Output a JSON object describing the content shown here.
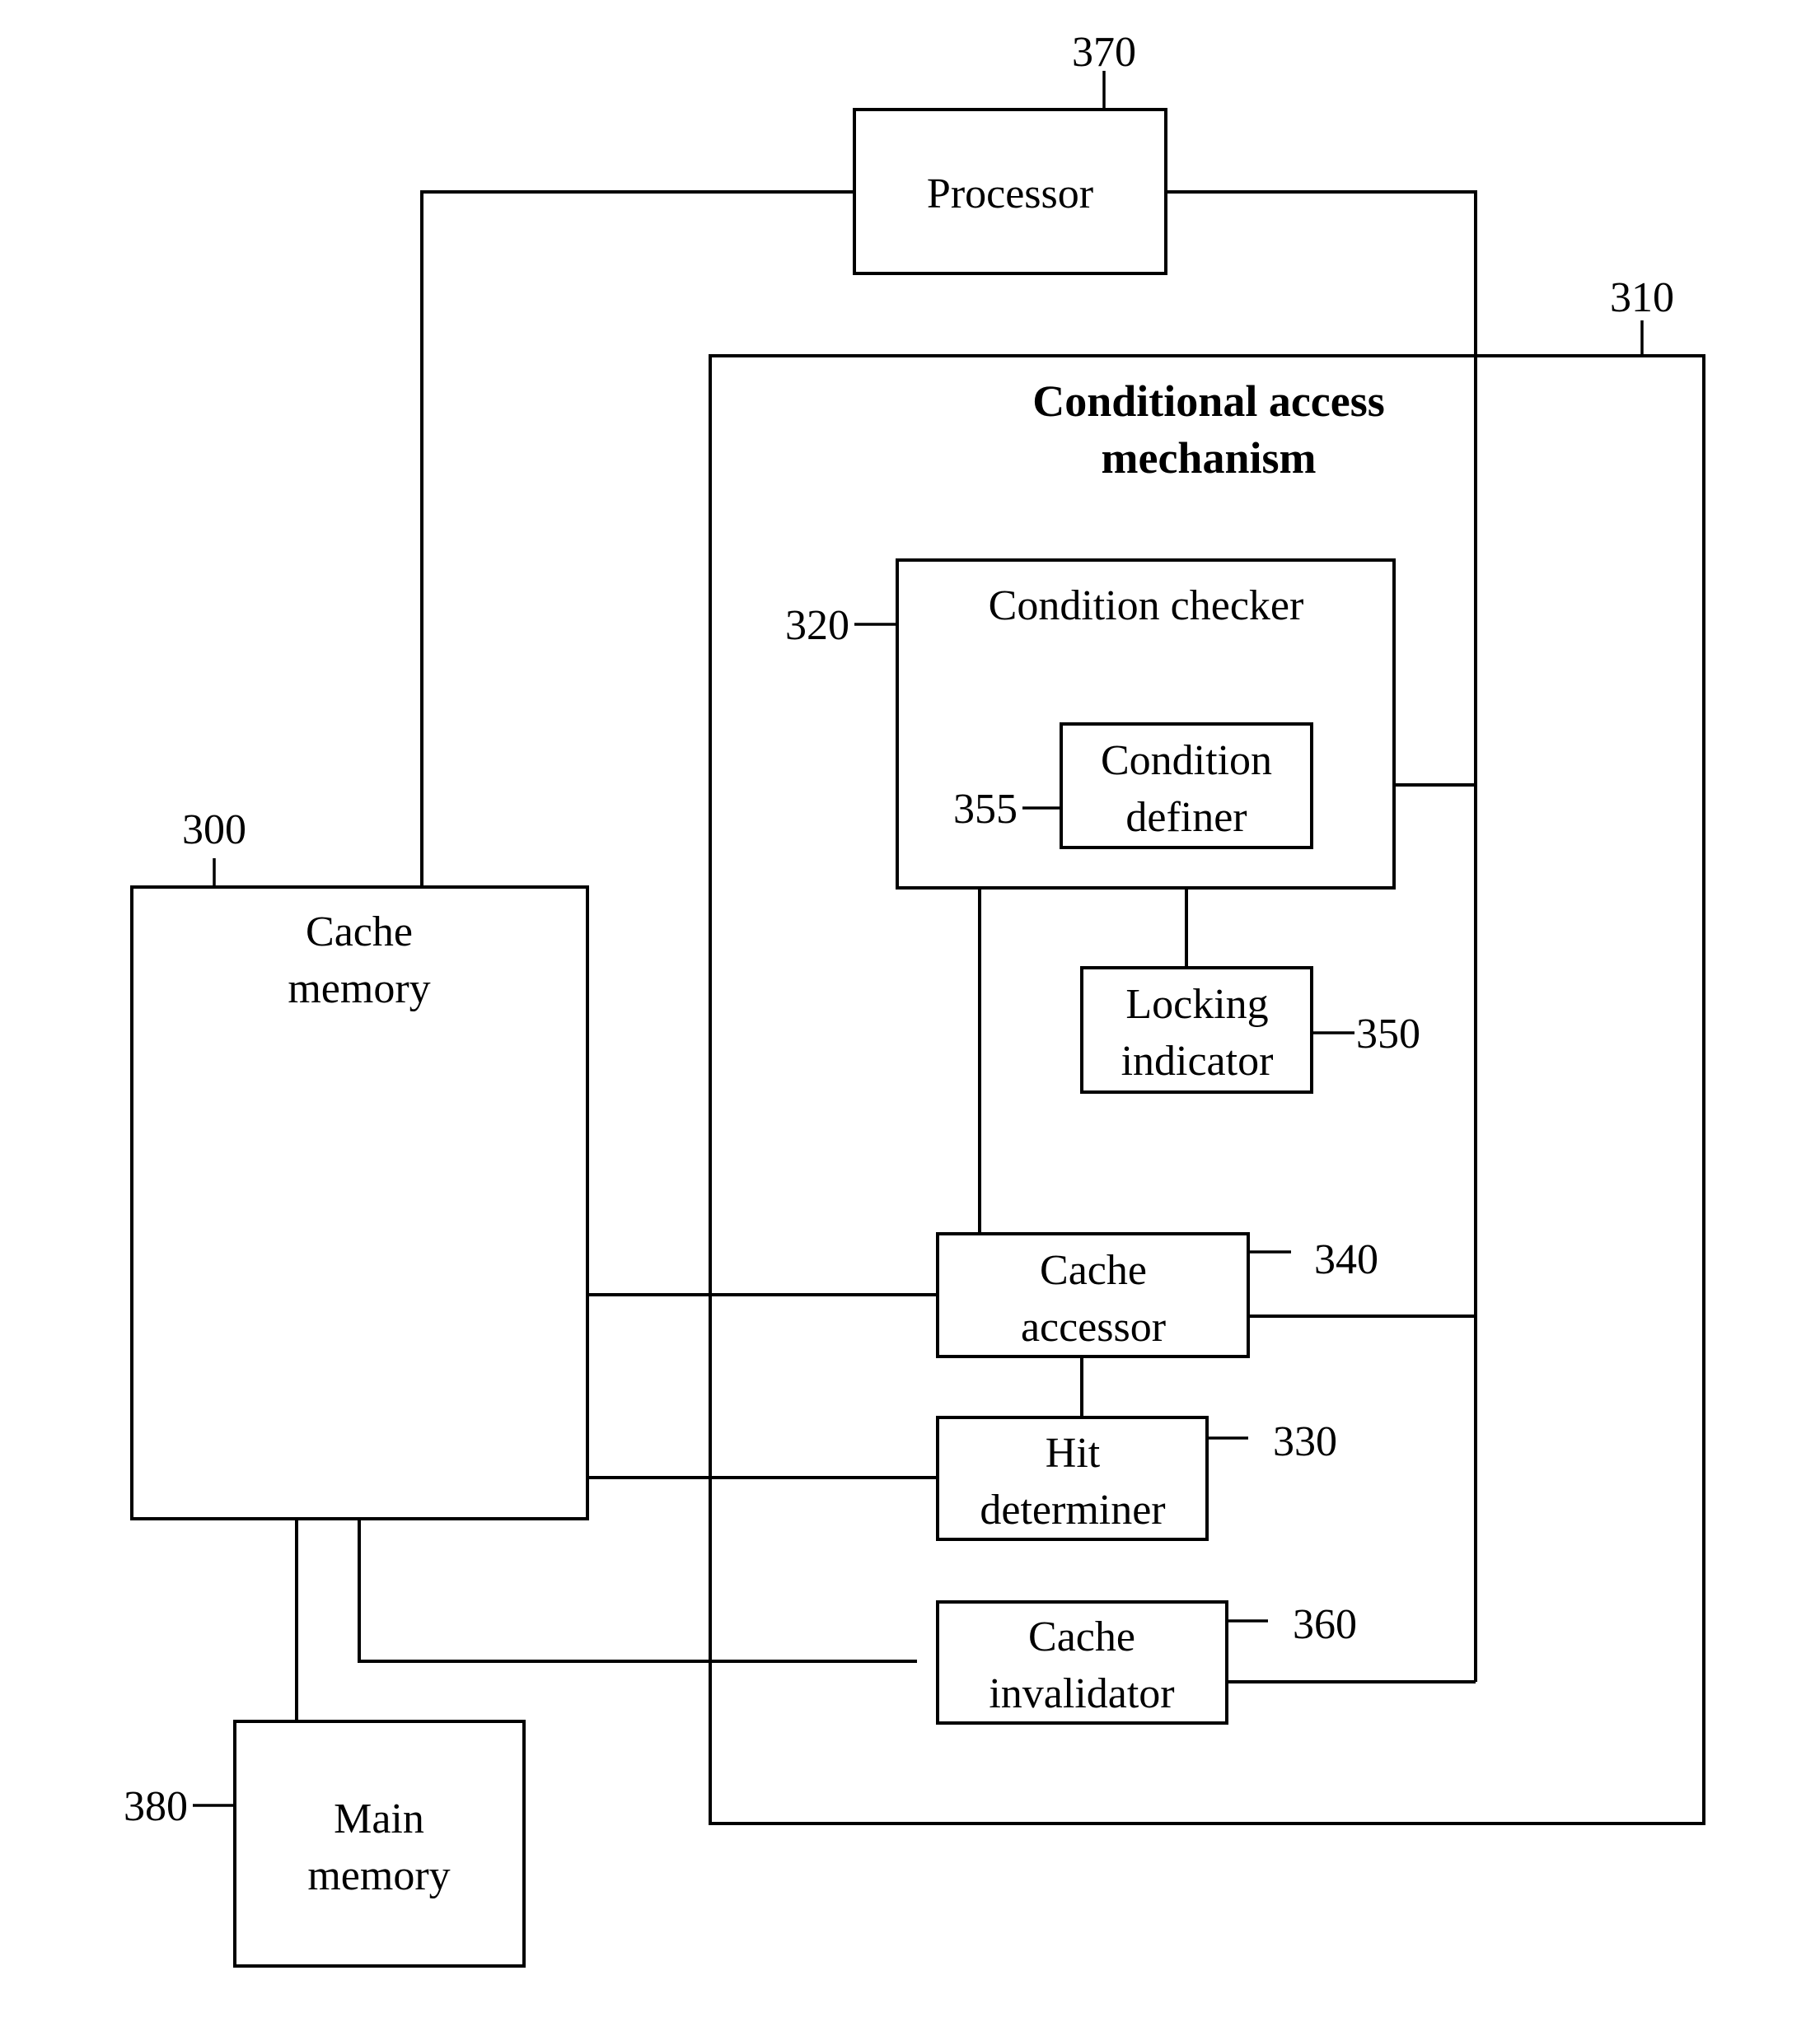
{
  "diagram": {
    "title": [
      "Conditional access",
      "mechanism"
    ],
    "blocks": {
      "processor": {
        "label": [
          "Processor"
        ],
        "ref": "370"
      },
      "conditional_access_mechanism": {
        "ref": "310"
      },
      "condition_checker": {
        "label": [
          "Condition checker"
        ],
        "ref": "320"
      },
      "condition_definer": {
        "label": [
          "Condition",
          "definer"
        ],
        "ref": "355"
      },
      "locking_indicator": {
        "label": [
          "Locking",
          "indicator"
        ],
        "ref": "350"
      },
      "cache_accessor": {
        "label": [
          "Cache",
          "accessor"
        ],
        "ref": "340"
      },
      "hit_determiner": {
        "label": [
          "Hit",
          "determiner"
        ],
        "ref": "330"
      },
      "cache_invalidator": {
        "label": [
          "Cache",
          "invalidator"
        ],
        "ref": "360"
      },
      "cache_memory": {
        "label": [
          "Cache",
          "memory"
        ],
        "ref": "300"
      },
      "main_memory": {
        "label": [
          "Main",
          "memory"
        ],
        "ref": "380"
      }
    },
    "connections": [
      [
        "processor",
        "cache_memory"
      ],
      [
        "processor",
        "bus"
      ],
      [
        "condition_definer",
        "bus"
      ],
      [
        "condition_definer",
        "locking_indicator"
      ],
      [
        "condition_checker",
        "cache_accessor"
      ],
      [
        "cache_memory",
        "cache_accessor"
      ],
      [
        "cache_accessor",
        "bus"
      ],
      [
        "cache_accessor",
        "hit_determiner"
      ],
      [
        "cache_memory",
        "hit_determiner"
      ],
      [
        "cache_memory",
        "cache_invalidator"
      ],
      [
        "cache_invalidator",
        "bus"
      ],
      [
        "cache_memory",
        "main_memory"
      ]
    ]
  }
}
